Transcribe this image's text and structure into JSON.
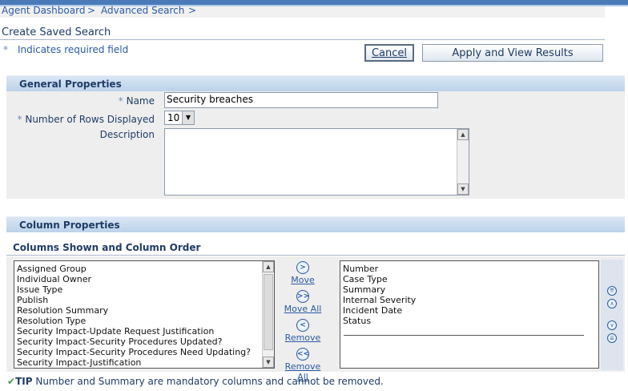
{
  "breadcrumbs": [
    {
      "label": "Agent Dashboard"
    },
    {
      "label": "Advanced Search"
    }
  ],
  "breadcrumb_separator": ">",
  "page_title": "Create Saved Search",
  "required_indicator": {
    "star": "*",
    "text": "Indicates required field"
  },
  "buttons": {
    "cancel": "Cancel",
    "apply": "Apply and View Results"
  },
  "general_properties": {
    "header": "General Properties",
    "name_label": "Name",
    "name_value": "Security breaches",
    "rows_label": "Number of Rows Displayed",
    "rows_value": "10",
    "description_label": "Description"
  },
  "column_properties": {
    "header": "Column Properties",
    "subheader": "Columns Shown and Column Order",
    "available_columns": [
      "Assigned Group",
      "Individual Owner",
      "Issue Type",
      "Publish",
      "Resolution Summary",
      "Resolution Type",
      "Security Impact-Update Request Justification",
      "Security Impact-Security Procedures Updated?",
      "Security Impact-Security Procedures Need Updating?",
      "Security Impact-Justification"
    ],
    "selected_columns": [
      "Number",
      "Case Type",
      "Summary",
      "Internal Severity",
      "Incident Date",
      "Status"
    ],
    "controls": {
      "move": "Move",
      "move_all": "Move All",
      "remove": "Remove",
      "remove_all": "Remove All"
    }
  },
  "tip": {
    "label": "TIP",
    "text": "Number and Summary are mandatory columns and cannot be removed."
  },
  "colors": {
    "accent": "#2b5aa3",
    "header_text": "#1f3c66",
    "section_header_bg": "#bcd2ea",
    "panel_bg": "#eeeeee"
  }
}
